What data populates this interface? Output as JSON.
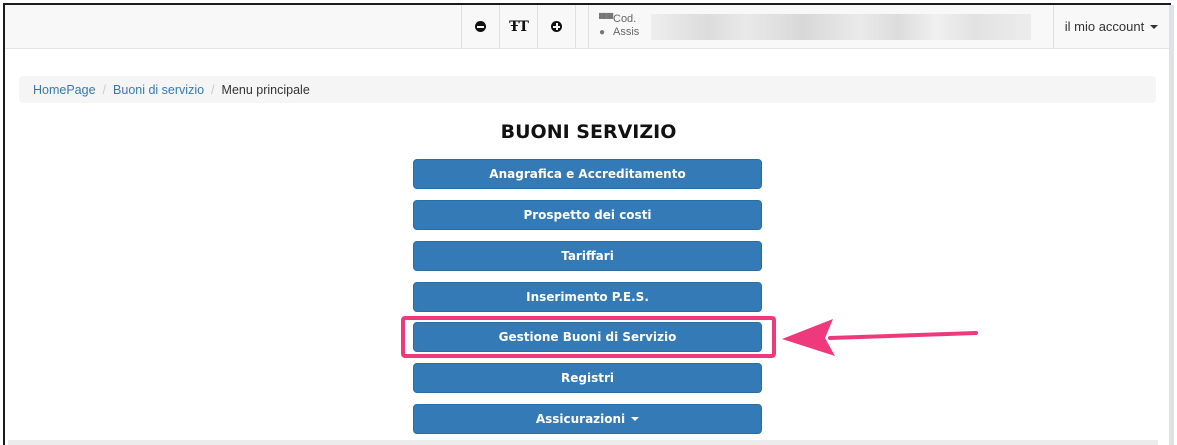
{
  "navbar": {
    "zoom_out_icon": "minus-circle-icon",
    "font_size_icon": "text-height-icon",
    "zoom_in_icon": "plus-circle-icon",
    "user_line1": "Cod.",
    "user_line2": "Assis",
    "account_label": "il mio account"
  },
  "breadcrumb": {
    "home": "HomePage",
    "section": "Buoni di servizio",
    "current": "Menu principale",
    "separator": "/"
  },
  "page": {
    "title": "BUONI SERVIZIO"
  },
  "menu": {
    "items": [
      {
        "label": "Anagrafica e Accreditamento"
      },
      {
        "label": "Prospetto dei costi"
      },
      {
        "label": "Tariffari"
      },
      {
        "label": "Inserimento P.E.S."
      },
      {
        "label": "Gestione Buoni di Servizio"
      },
      {
        "label": "Registri"
      },
      {
        "label": "Assicurazioni"
      }
    ]
  },
  "colors": {
    "primary": "#337ab7",
    "highlight": "#ee3a7c"
  }
}
